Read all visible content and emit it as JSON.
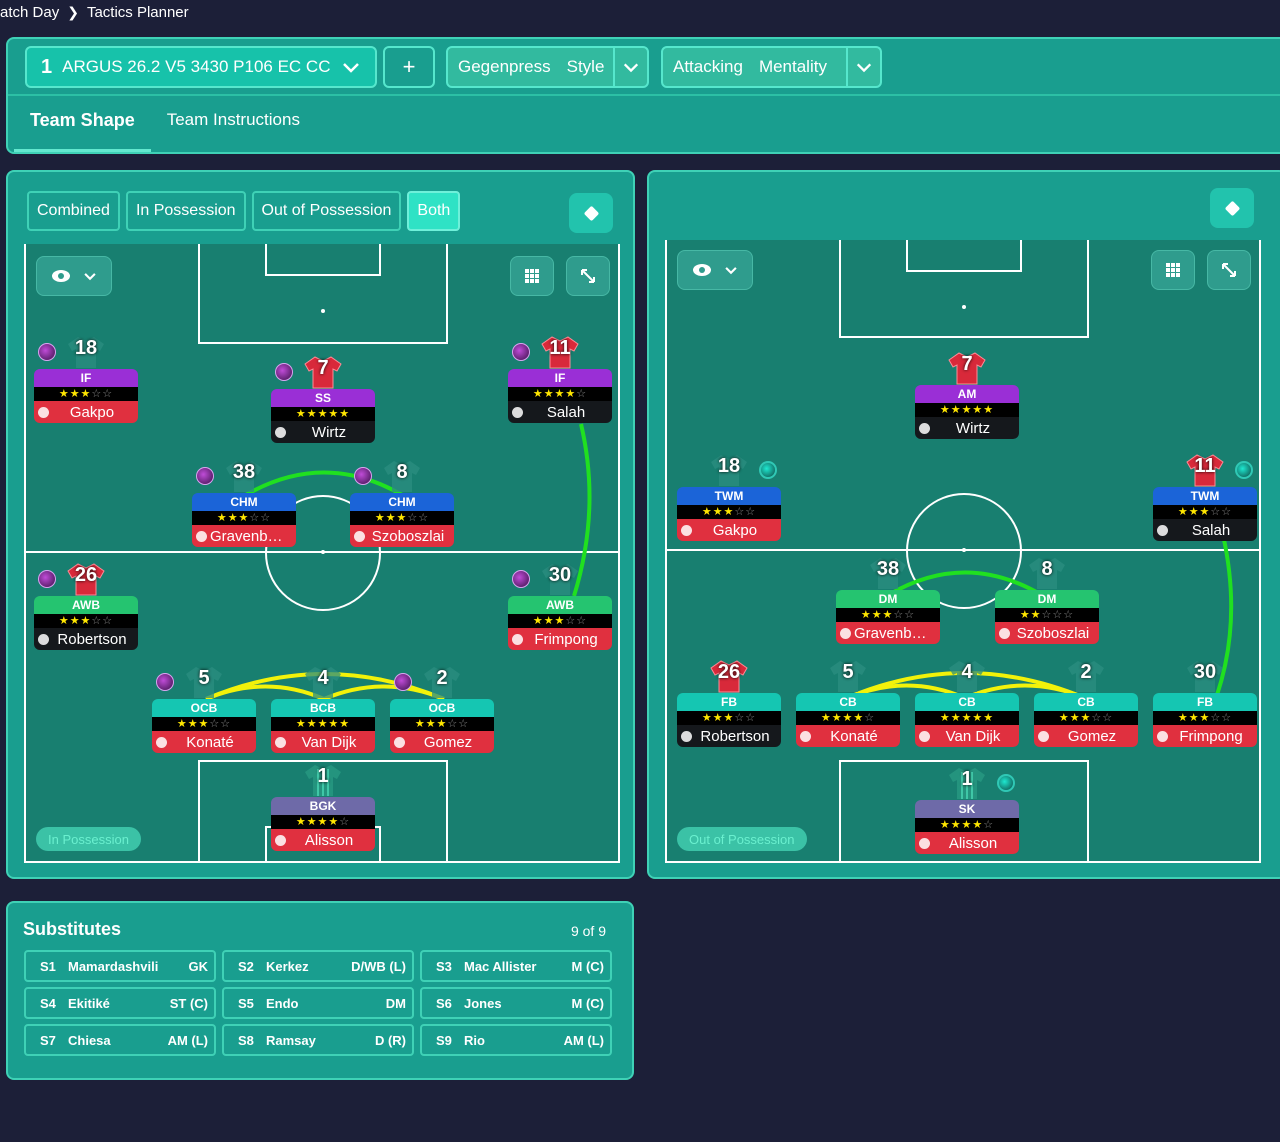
{
  "breadcrumb": {
    "parent": "atch Day",
    "current": "Tactics Planner"
  },
  "tactic": {
    "number": "1",
    "name": "ARGUS 26.2 V5 3430 P106 EC CC"
  },
  "style": {
    "value": "Gegenpress",
    "label": "Style"
  },
  "mentality": {
    "value": "Attacking",
    "label": "Mentality"
  },
  "tabs": {
    "shape": "Team Shape",
    "instructions": "Team Instructions"
  },
  "filters": [
    "Combined",
    "In Possession",
    "Out of Possession",
    "Both"
  ],
  "left_pitch": {
    "badge": "In Possession",
    "players": [
      {
        "num": "18",
        "role": "IF",
        "stars": 3,
        "half": false,
        "name": "Gakpo",
        "rc": "purple",
        "nc": "red",
        "shirt": "grey",
        "orb": "purple"
      },
      {
        "num": "7",
        "role": "SS",
        "stars": 4,
        "half": true,
        "name": "Wirtz",
        "rc": "purple",
        "nc": "black",
        "shirt": "red",
        "orb": "purple"
      },
      {
        "num": "11",
        "role": "IF",
        "stars": 4,
        "half": false,
        "name": "Salah",
        "rc": "purple",
        "nc": "black",
        "shirt": "red",
        "orb": "purple"
      },
      {
        "num": "38",
        "role": "CHM",
        "stars": 3,
        "half": false,
        "name": "Gravenber...",
        "rc": "blue",
        "nc": "red",
        "shirt": "grey",
        "orb": "purple"
      },
      {
        "num": "8",
        "role": "CHM",
        "stars": 3,
        "half": false,
        "name": "Szoboszlai",
        "rc": "blue",
        "nc": "red",
        "shirt": "grey",
        "orb": "purple"
      },
      {
        "num": "26",
        "role": "AWB",
        "stars": 2,
        "half": true,
        "name": "Robertson",
        "rc": "green",
        "nc": "black",
        "shirt": "red",
        "orb": "purple"
      },
      {
        "num": "30",
        "role": "AWB",
        "stars": 3,
        "half": false,
        "name": "Frimpong",
        "rc": "green",
        "nc": "red",
        "shirt": "grey",
        "orb": "purple"
      },
      {
        "num": "5",
        "role": "OCB",
        "stars": 3,
        "half": false,
        "name": "Konaté",
        "rc": "teal",
        "nc": "red",
        "shirt": "grey",
        "orb": "purple"
      },
      {
        "num": "4",
        "role": "BCB",
        "stars": 4,
        "half": true,
        "name": "Van Dijk",
        "rc": "teal",
        "nc": "red",
        "shirt": "grey",
        "orb": ""
      },
      {
        "num": "2",
        "role": "OCB",
        "stars": 2,
        "half": true,
        "name": "Gomez",
        "rc": "teal",
        "nc": "red",
        "shirt": "grey",
        "orb": "purple"
      },
      {
        "num": "1",
        "role": "BGK",
        "stars": 4,
        "half": false,
        "name": "Alisson",
        "rc": "grey",
        "nc": "red",
        "shirt": "stripe",
        "orb": ""
      }
    ]
  },
  "right_pitch": {
    "badge": "Out of Possession",
    "players": [
      {
        "num": "7",
        "role": "AM",
        "stars": 4,
        "half": true,
        "name": "Wirtz",
        "rc": "purple",
        "nc": "black",
        "shirt": "red",
        "orb": ""
      },
      {
        "num": "18",
        "role": "TWM",
        "stars": 2,
        "half": true,
        "name": "Gakpo",
        "rc": "blue",
        "nc": "red",
        "shirt": "grey",
        "orb": "teal"
      },
      {
        "num": "11",
        "role": "TWM",
        "stars": 3,
        "half": false,
        "name": "Salah",
        "rc": "blue",
        "nc": "black",
        "shirt": "red",
        "orb": "teal"
      },
      {
        "num": "38",
        "role": "DM",
        "stars": 3,
        "half": false,
        "name": "Gravenber...",
        "rc": "green",
        "nc": "red",
        "shirt": "grey",
        "orb": ""
      },
      {
        "num": "8",
        "role": "DM",
        "stars": 2,
        "half": false,
        "name": "Szoboszlai",
        "rc": "green",
        "nc": "red",
        "shirt": "grey",
        "orb": ""
      },
      {
        "num": "26",
        "role": "FB",
        "stars": 2,
        "half": true,
        "name": "Robertson",
        "rc": "teal",
        "nc": "black",
        "shirt": "red",
        "orb": ""
      },
      {
        "num": "5",
        "role": "CB",
        "stars": 3,
        "half": true,
        "name": "Konaté",
        "rc": "teal",
        "nc": "red",
        "shirt": "grey",
        "orb": ""
      },
      {
        "num": "4",
        "role": "CB",
        "stars": 4,
        "half": true,
        "name": "Van Dijk",
        "rc": "teal",
        "nc": "red",
        "shirt": "grey",
        "orb": ""
      },
      {
        "num": "2",
        "role": "CB",
        "stars": 2,
        "half": true,
        "name": "Gomez",
        "rc": "teal",
        "nc": "red",
        "shirt": "grey",
        "orb": ""
      },
      {
        "num": "30",
        "role": "FB",
        "stars": 2,
        "half": true,
        "name": "Frimpong",
        "rc": "teal",
        "nc": "red",
        "shirt": "grey",
        "orb": ""
      },
      {
        "num": "1",
        "role": "SK",
        "stars": 4,
        "half": false,
        "name": "Alisson",
        "rc": "grey",
        "nc": "red",
        "shirt": "stripe",
        "orb": "teal"
      }
    ]
  },
  "substitutes": {
    "title": "Substitutes",
    "count": "9 of 9",
    "items": [
      {
        "id": "S1",
        "name": "Mamardashvili",
        "pos": "GK"
      },
      {
        "id": "S2",
        "name": "Kerkez",
        "pos": "D/WB (L)"
      },
      {
        "id": "S3",
        "name": "Mac Allister",
        "pos": "M (C)"
      },
      {
        "id": "S4",
        "name": "Ekitiké",
        "pos": "ST (C)"
      },
      {
        "id": "S5",
        "name": "Endo",
        "pos": "DM"
      },
      {
        "id": "S6",
        "name": "Jones",
        "pos": "M (C)"
      },
      {
        "id": "S7",
        "name": "Chiesa",
        "pos": "AM (L)"
      },
      {
        "id": "S8",
        "name": "Ramsay",
        "pos": "D (R)"
      },
      {
        "id": "S9",
        "name": "Rio",
        "pos": "AM (L)"
      }
    ]
  },
  "icons": {
    "chevron": "chevron-down-icon",
    "add": "plus-icon",
    "eye": "eye-icon",
    "grid": "grid-icon",
    "expand": "expand-icon",
    "diamond": "diamond-icon"
  },
  "colors": {
    "panel": "#199e8f",
    "accent": "#2fe2c5",
    "background": "#1c1f38",
    "link_green": "#20e020",
    "link_yellow": "#f2f20a"
  }
}
